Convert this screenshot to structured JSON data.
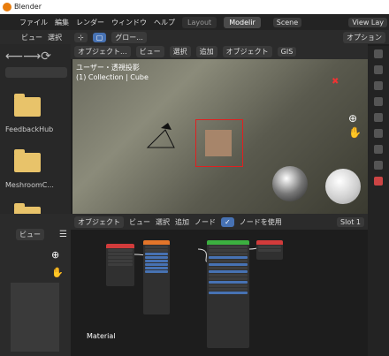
{
  "window": {
    "title": "Blender"
  },
  "menubar": {
    "items": [
      "ファイル",
      "編集",
      "レンダー",
      "ウィンドウ",
      "ヘルプ"
    ],
    "workspaces": [
      "Layout",
      "Modelir"
    ],
    "scene": "Scene",
    "view_layer": "View Lay"
  },
  "viewport_header": {
    "mode": "オブジェクト...",
    "menus": [
      "ビュー",
      "選択",
      "追加",
      "オブジェクト"
    ],
    "gis": "GIS",
    "orientation": "グロー...",
    "options": "オプション"
  },
  "left_header": {
    "view": "ビュー",
    "select": "選択"
  },
  "viewport": {
    "line1": "ユーザー・透視投影",
    "line2": "(1) Collection | Cube"
  },
  "file_browser": {
    "items": [
      "FeedbackHub",
      "MeshroomC...",
      ""
    ]
  },
  "image_editor": {
    "view": "ビュー"
  },
  "node_editor": {
    "mode": "オブジェクト",
    "menus": [
      "ビュー",
      "選択",
      "追加",
      "ノード"
    ],
    "use_nodes": "ノードを使用",
    "slot": "Slot 1",
    "material": "Material"
  },
  "colors": {
    "accent": "#4772b3",
    "selection_box": "#e02020",
    "node_texture": "#e3752a",
    "node_shader": "#3cb040",
    "node_output": "#d23b3b"
  }
}
